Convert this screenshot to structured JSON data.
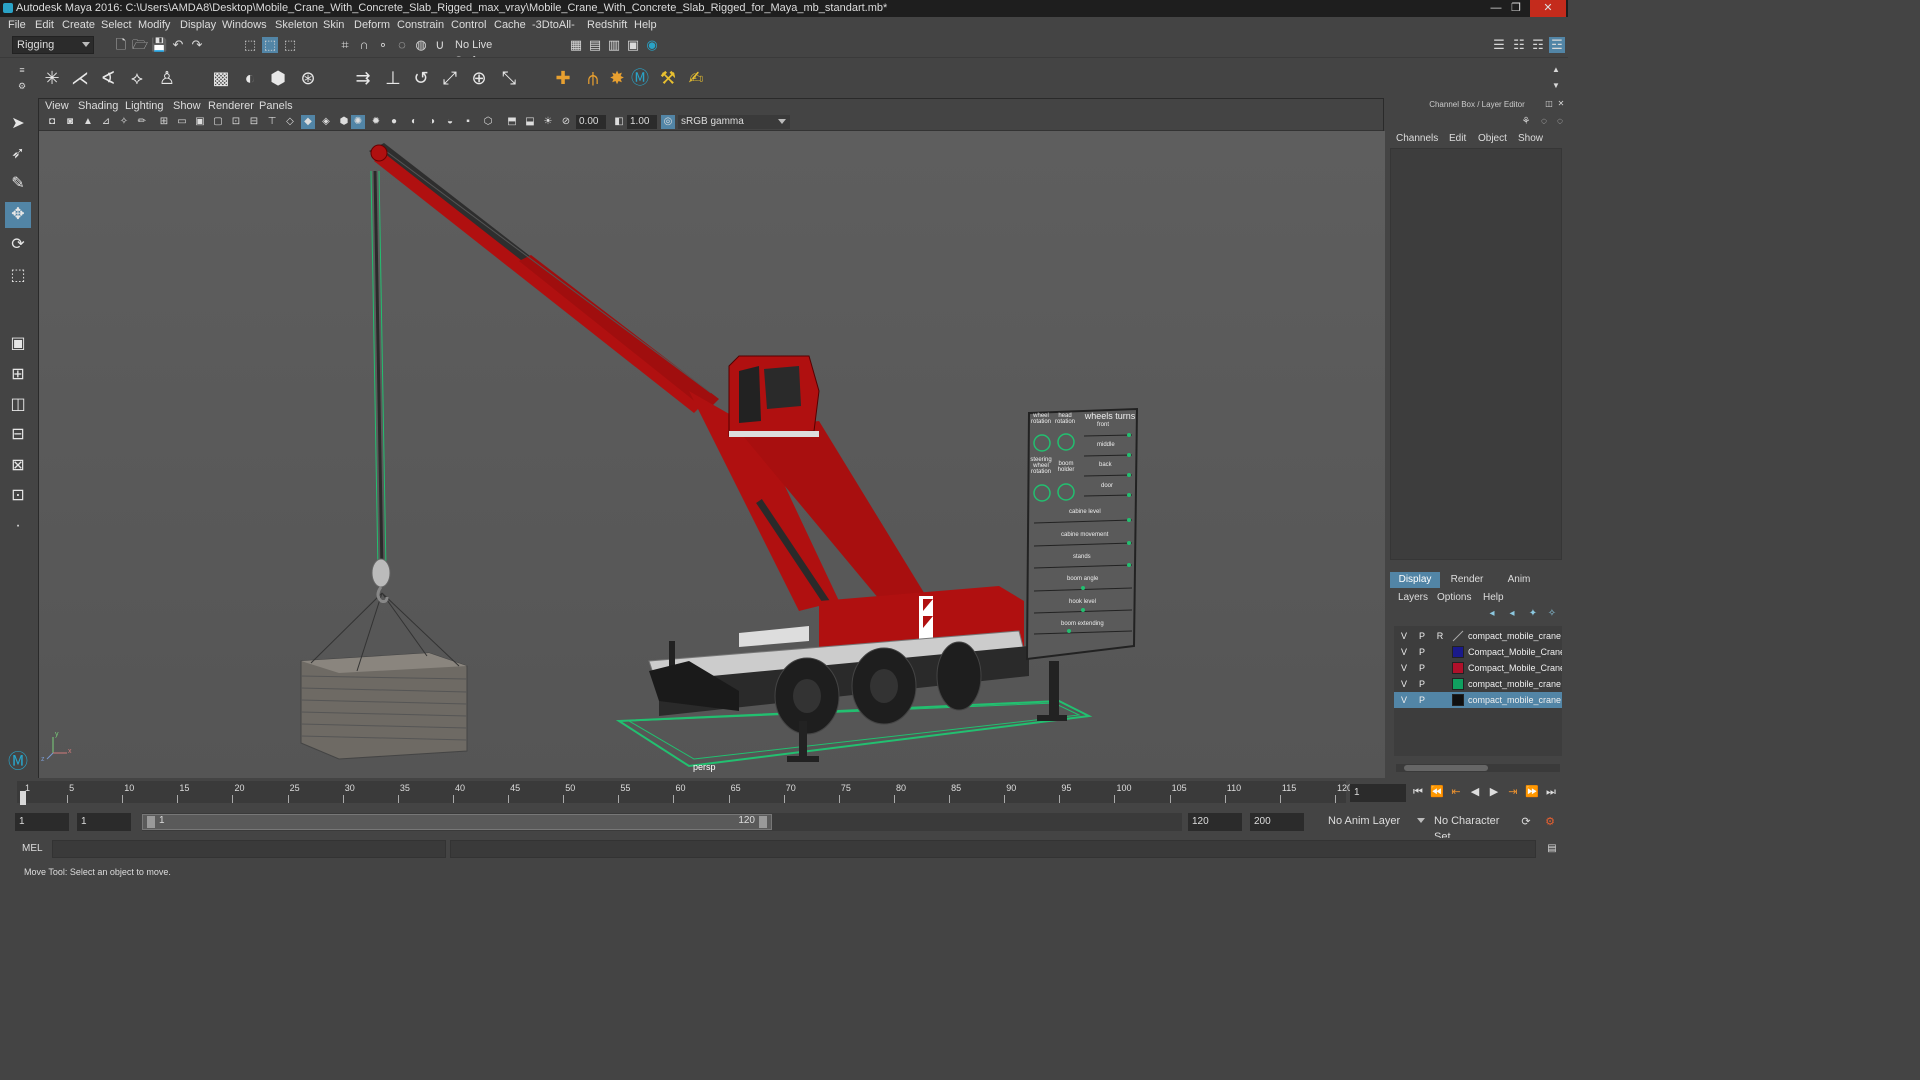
{
  "window": {
    "title": "Autodesk Maya 2016: C:\\Users\\AMDA8\\Desktop\\Mobile_Crane_With_Concrete_Slab_Rigged_max_vray\\Mobile_Crane_With_Concrete_Slab_Rigged_for_Maya_mb_standart.mb*",
    "minimize": "—",
    "maximize": "❐",
    "close": "✕"
  },
  "menu": [
    "File",
    "Edit",
    "Create",
    "Select",
    "Modify",
    "Display",
    "Windows",
    "Skeleton",
    "Skin",
    "Deform",
    "Constrain",
    "Control",
    "Cache",
    "-3DtoAll-",
    "Redshift",
    "Help"
  ],
  "statusline": {
    "menu_set": "Rigging",
    "live_surface": "No Live Surface"
  },
  "viewport": {
    "menu": [
      "View",
      "Shading",
      "Lighting",
      "Show",
      "Renderer",
      "Panels"
    ],
    "exposure": "0.00",
    "gamma": "1.00",
    "color_space": "sRGB gamma",
    "camera_label": "persp",
    "axis_y": "y",
    "axis_x": "x",
    "axis_z": "z"
  },
  "control_board": {
    "wheel_rotation": "wheel rotation",
    "head_rotation": "head rotation",
    "wheels_turns": "wheels turns",
    "front": "front",
    "middle": "middle",
    "back": "back",
    "steering_wheel_rotation": "steering wheel rotation",
    "boom_holder": "boom holder",
    "door": "door",
    "cabine_level": "cabine level",
    "cabine_movement": "cabine movement",
    "stands": "stands",
    "boom_angle": "boom angle",
    "hook_level": "hook level",
    "boom_extending": "boom extending"
  },
  "channel_box": {
    "title": "Channel Box / Layer Editor",
    "tabs": [
      "Channels",
      "Edit",
      "Object",
      "Show"
    ]
  },
  "layer_editor": {
    "tabs": [
      "Display",
      "Render",
      "Anim"
    ],
    "active_tab": "Display",
    "submenu": [
      "Layers",
      "Options",
      "Help"
    ],
    "layers": [
      {
        "v": "V",
        "p": "P",
        "r": "R",
        "name": "compact_mobile_crane",
        "color": "#3d3d3d",
        "selected": false
      },
      {
        "v": "V",
        "p": "P",
        "r": "",
        "name": "Compact_Mobile_Crane",
        "color": "#1a1a8a",
        "selected": false
      },
      {
        "v": "V",
        "p": "P",
        "r": "",
        "name": "Compact_Mobile_Crane",
        "color": "#b0102a",
        "selected": false
      },
      {
        "v": "V",
        "p": "P",
        "r": "",
        "name": "compact_mobile_crane",
        "color": "#10a060",
        "selected": false
      },
      {
        "v": "V",
        "p": "P",
        "r": "",
        "name": "compact_mobile_crane",
        "color": "#101010",
        "selected": true
      }
    ]
  },
  "timeslider": {
    "ticks": [
      "1",
      "5",
      "10",
      "15",
      "20",
      "25",
      "30",
      "35",
      "40",
      "45",
      "50",
      "55",
      "60",
      "65",
      "70",
      "75",
      "80",
      "85",
      "90",
      "95",
      "100",
      "105",
      "110",
      "115",
      "120"
    ],
    "current_frame": "1"
  },
  "rangeslider": {
    "start": "1",
    "playback_start": "1",
    "range_start_label": "1",
    "range_end_label": "120",
    "playback_end": "120",
    "end": "200",
    "anim_layer": "No Anim Layer",
    "character_set": "No Character Set"
  },
  "command_line": {
    "label": "MEL"
  },
  "help_line": "Move Tool: Select an object to move.",
  "colors": {
    "crane_red": "#b01010",
    "rig_green": "#22c070",
    "selection_blue": "#5285a6",
    "accent": "#2aa3c7"
  }
}
